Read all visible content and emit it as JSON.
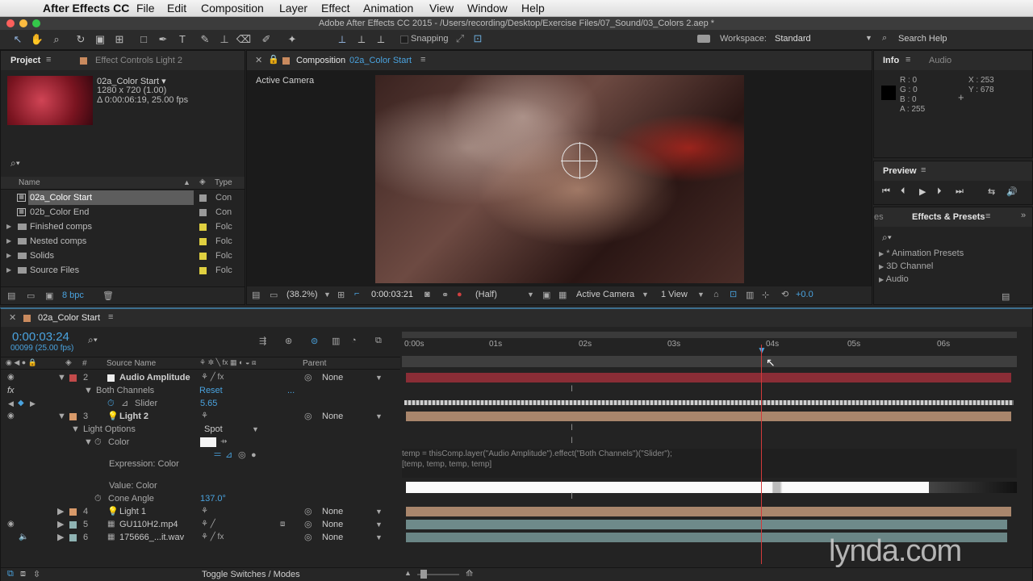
{
  "menubar": {
    "app": "After Effects CC",
    "items": [
      "File",
      "Edit",
      "Composition",
      "Layer",
      "Effect",
      "Animation",
      "View",
      "Window",
      "Help"
    ]
  },
  "titlebar": {
    "text": "Adobe After Effects CC 2015 - /Users/recording/Desktop/Exercise Files/07_Sound/03_Colors 2.aep *"
  },
  "toolbar": {
    "snapping": "Snapping",
    "workspace_label": "Workspace:",
    "workspace_value": "Standard",
    "search_help": "Search Help"
  },
  "project": {
    "tab_project": "Project",
    "tab_effect_controls": "Effect Controls Light 2",
    "thumb_name": "02a_Color Start ▾",
    "thumb_size": "1280 x 720 (1.00)",
    "thumb_duration": "Δ 0:00:06:19, 25.00 fps",
    "col_name": "Name",
    "col_type": "Type",
    "items": [
      {
        "name": "02a_Color Start",
        "type": "Con",
        "kind": "comp",
        "selected": true
      },
      {
        "name": "02b_Color End",
        "type": "Con",
        "kind": "comp",
        "selected": false
      },
      {
        "name": "Finished comps",
        "type": "Folc",
        "kind": "folder",
        "selected": false
      },
      {
        "name": "Nested comps",
        "type": "Folc",
        "kind": "folder",
        "selected": false
      },
      {
        "name": "Solids",
        "type": "Folc",
        "kind": "folder",
        "selected": false
      },
      {
        "name": "Source Files",
        "type": "Folc",
        "kind": "folder",
        "selected": false
      }
    ],
    "bpc": "8 bpc"
  },
  "composition": {
    "tab_label": "Composition",
    "tab_name": "02a_Color Start",
    "active_camera_label": "Active Camera",
    "zoom": "(38.2%)",
    "timecode": "0:00:03:21",
    "resolution": "(Half)",
    "camera": "Active Camera",
    "views": "1 View",
    "exposure": "+0.0"
  },
  "info": {
    "tab_info": "Info",
    "tab_audio": "Audio",
    "r": "R : 0",
    "g": "G : 0",
    "b": "B : 0",
    "a": "A : 255",
    "x": "X : 253",
    "y": "Y : 678"
  },
  "preview": {
    "title": "Preview"
  },
  "effects": {
    "tab_prev": "es",
    "title": "Effects & Presets",
    "items": [
      "* Animation Presets",
      "3D Channel",
      "Audio"
    ]
  },
  "timeline": {
    "tab_name": "02a_Color Start",
    "timecode": "0:00:03:24",
    "frames": "00099 (25.00 fps)",
    "col_num": "#",
    "col_source": "Source Name",
    "col_parent": "Parent",
    "ruler": [
      "0:00s",
      "01s",
      "02s",
      "03s",
      "04s",
      "05s",
      "06s"
    ],
    "layer_rows": {
      "l2": {
        "num": "2",
        "name": "Audio Amplitude",
        "parent": "None"
      },
      "both_channels": "Both Channels",
      "reset": "Reset",
      "dots": "...",
      "slider_label": "Slider",
      "slider_value": "5.65",
      "l3": {
        "num": "3",
        "name": "Light 2",
        "parent": "None"
      },
      "light_options": "Light Options",
      "light_type": "Spot",
      "color_label": "Color",
      "expression_label": "Expression: Color",
      "value_color": "Value: Color",
      "cone_angle_label": "Cone Angle",
      "cone_angle_value": "137.0°",
      "l4": {
        "num": "4",
        "name": "Light 1",
        "parent": "None"
      },
      "l5": {
        "num": "5",
        "name": "GU110H2.mp4",
        "parent": "None"
      },
      "l6": {
        "num": "6",
        "name": "175666_...it.wav",
        "parent": "None"
      }
    },
    "expression_line1": "temp = thisComp.layer(\"Audio Amplitude\").effect(\"Both Channels\")(\"Slider\");",
    "expression_line2": "[temp, temp, temp, temp]",
    "toggle_label": "Toggle Switches / Modes",
    "watermark": "lynda.com"
  },
  "colors": {
    "accent": "#4aa3df",
    "layer_red": "#8a2d36",
    "layer_tan": "#a9866c",
    "layer_teal": "#6e8a8a"
  }
}
